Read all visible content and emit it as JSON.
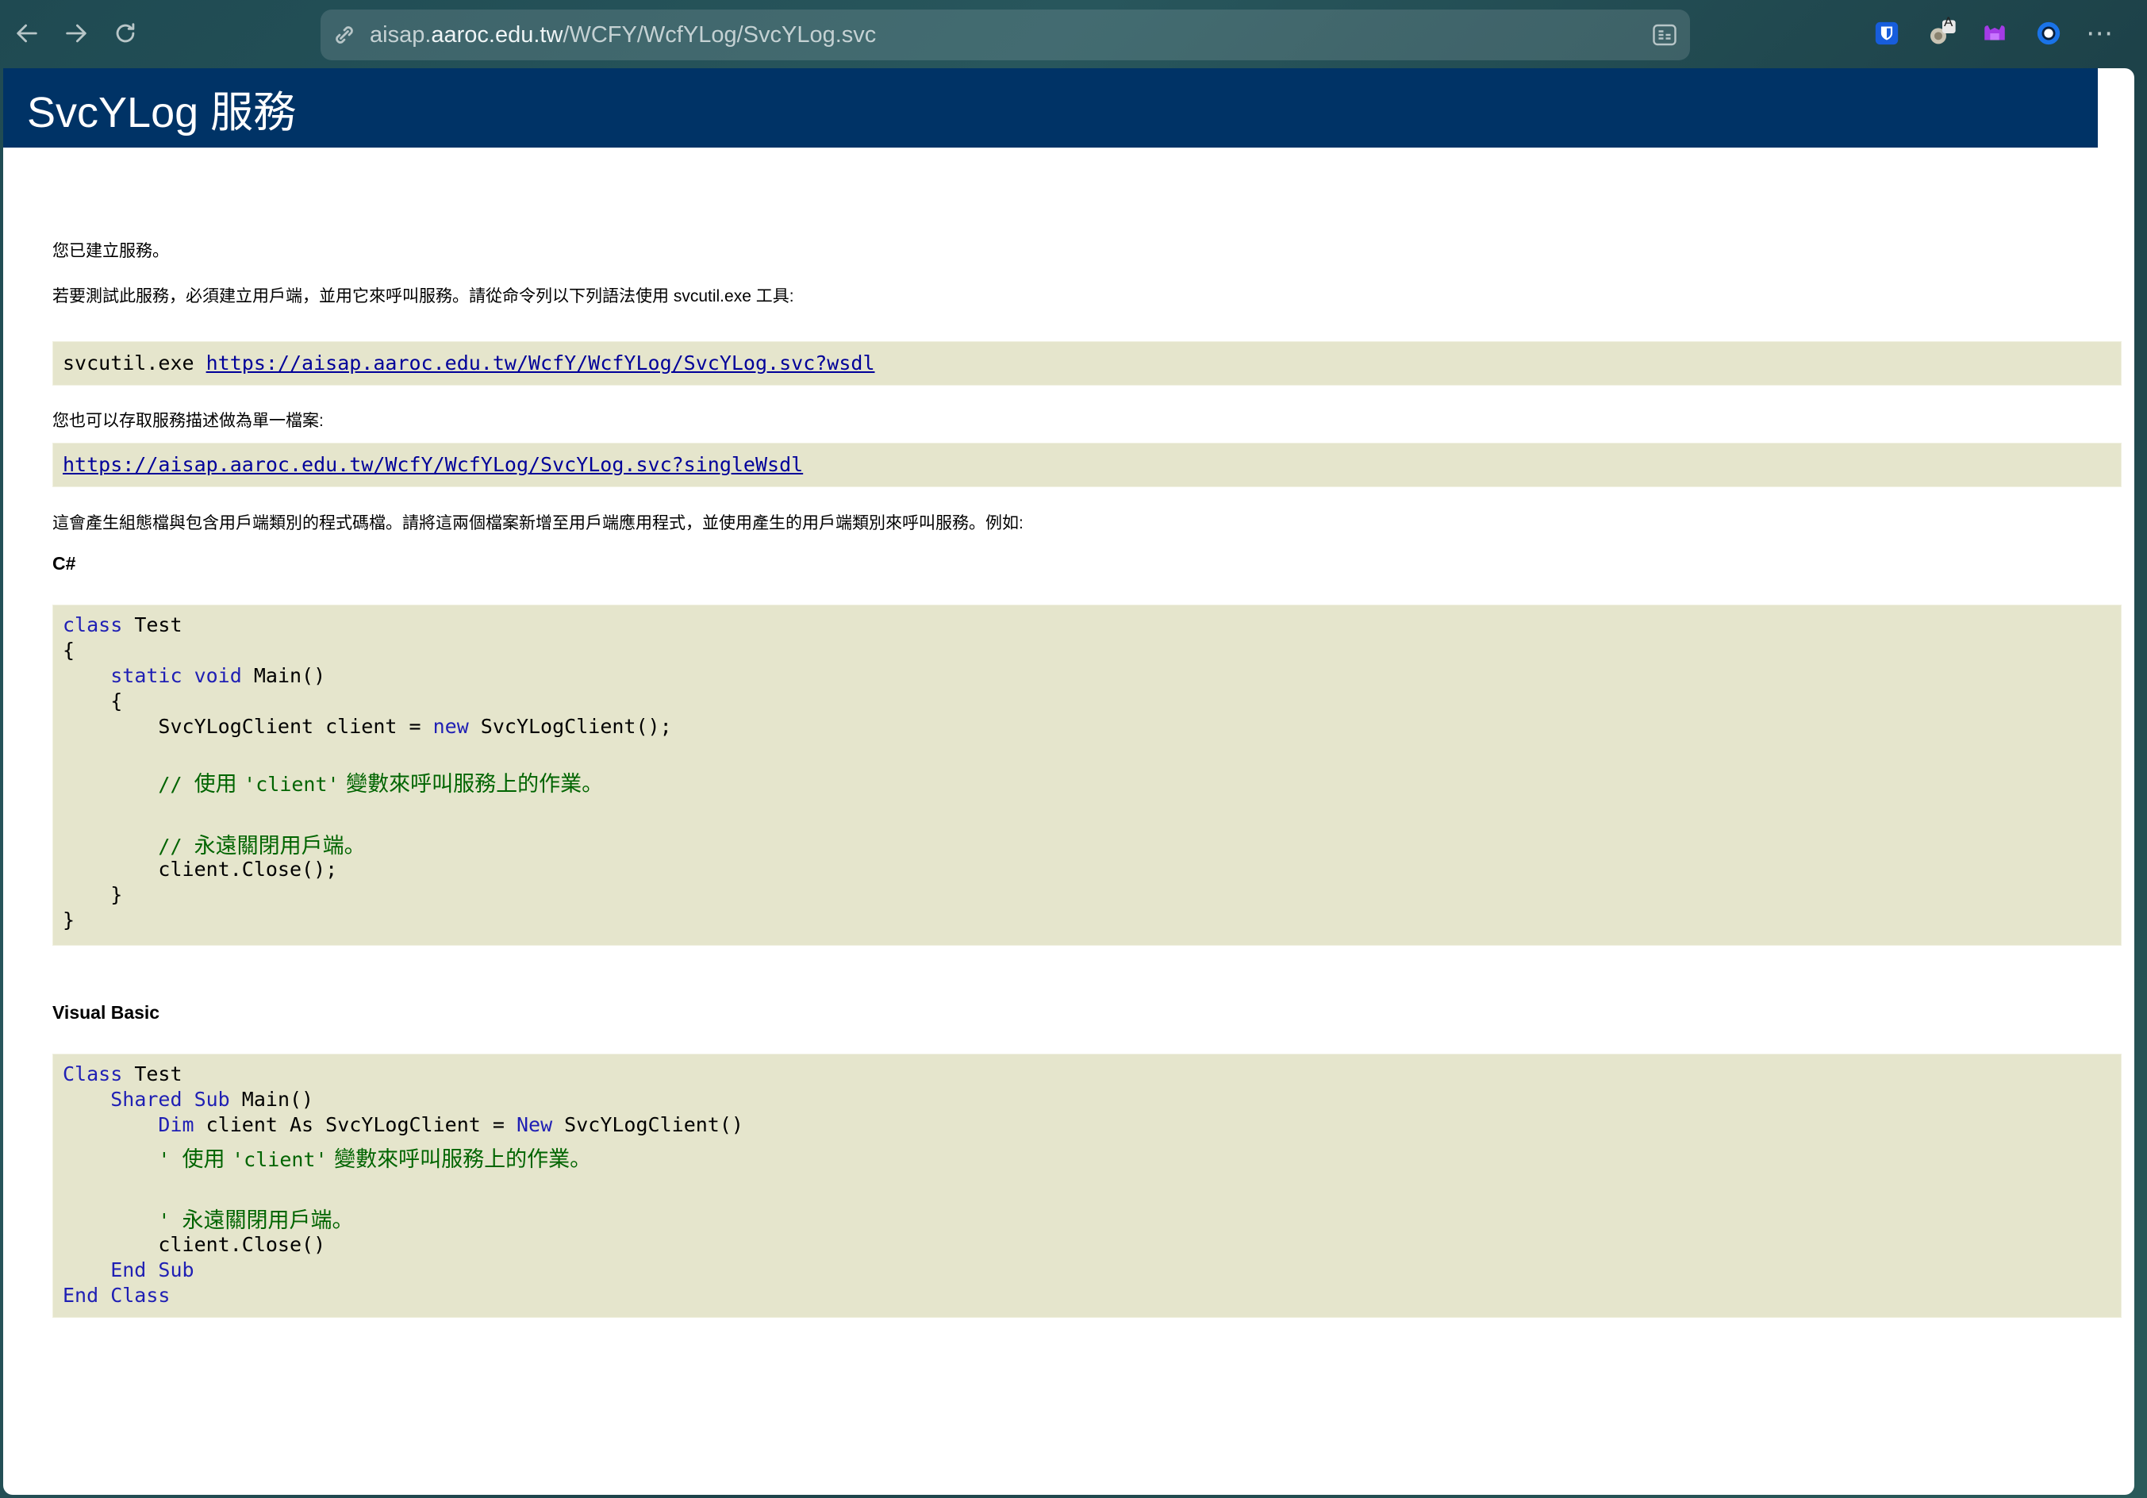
{
  "browser": {
    "url_prefix": "aisap.",
    "url_host": "aaroc.edu.tw",
    "url_path": "/WCFY/WcfYLog/SvcYLog.svc",
    "back_icon": "arrow-left-icon",
    "forward_icon": "arrow-right-icon",
    "reload_icon": "reload-icon",
    "extension_translate_badge": "A",
    "more_label": "⋯"
  },
  "page": {
    "title": "SvcYLog 服務",
    "created_text": "您已建立服務。",
    "test_text": "若要測試此服務，必須建立用戶端，並用它來呼叫服務。請從命令列以下列語法使用 svcutil.exe 工具:",
    "svcutil_cmd": "svcutil.exe ",
    "wsdl_link": "https://aisap.aaroc.edu.tw/WcfY/WcfYLog/SvcYLog.svc?wsdl",
    "single_file_text": "您也可以存取服務描述做為單一檔案:",
    "single_wsdl_link": "https://aisap.aaroc.edu.tw/WcfY/WcfYLog/SvcYLog.svc?singleWsdl",
    "generate_text": "這會產生組態檔與包含用戶端類別的程式碼檔。請將這兩個檔案新增至用戶端應用程式，並使用產生的用戶端類別來呼叫服務。例如:",
    "csharp_label": "C#",
    "vb_label": "Visual Basic"
  },
  "csharp": {
    "l1_kw": "class",
    "l1_rest": " Test",
    "l2": "{",
    "l3_pre": "    ",
    "l3_kw": "static void",
    "l3_rest": " Main()",
    "l4": "    {",
    "l5_pre": "        SvcYLogClient client = ",
    "l5_kw": "new",
    "l5_rest": " SvcYLogClient();",
    "l6_a": "        // ",
    "l6_b": "使用 ",
    "l6_c": "'client'",
    "l6_d": " 變數來呼叫服務上的作業。",
    "l7_a": "        // ",
    "l7_b": "永遠關閉用戶端。",
    "l8": "        client.Close();",
    "l9": "    }",
    "l10": "}"
  },
  "vb": {
    "l1_kw": "Class",
    "l1_rest": " Test",
    "l2_pre": "    ",
    "l2_kw": "Shared Sub",
    "l2_rest": " Main()",
    "l3_pre": "        ",
    "l3_kw": "Dim",
    "l3_mid": " client As SvcYLogClient = ",
    "l3_kw2": "New",
    "l3_rest": " SvcYLogClient()",
    "l4_a": "        ' ",
    "l4_b": "使用 ",
    "l4_c": "'client'",
    "l4_d": " 變數來呼叫服務上的作業。",
    "l5_a": "        ' ",
    "l5_b": "永遠關閉用戶端。",
    "l6": "        client.Close()",
    "l7_kw": "    End Sub",
    "l8_kw": "End Class"
  }
}
